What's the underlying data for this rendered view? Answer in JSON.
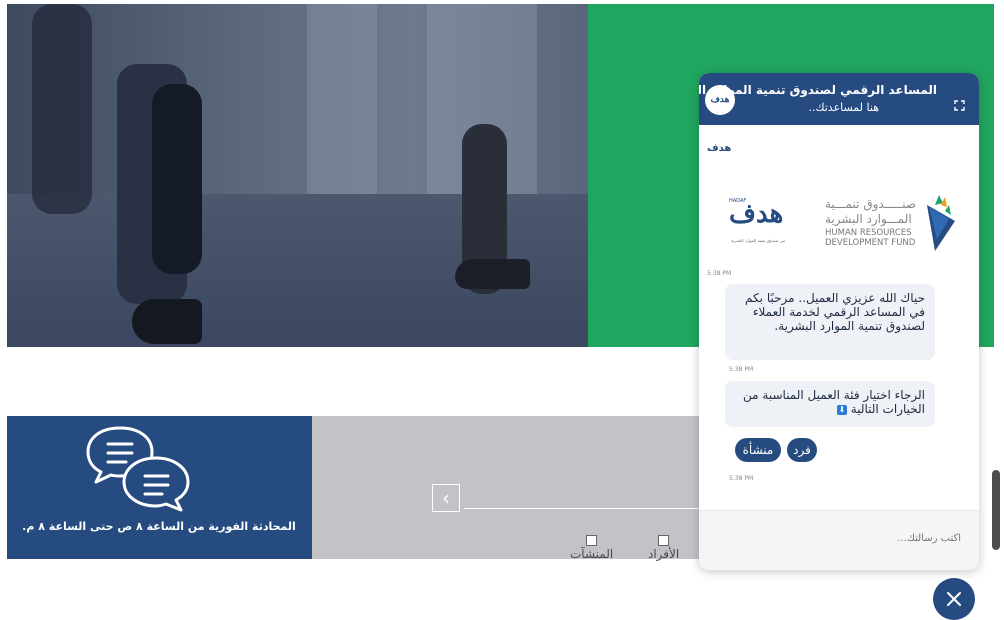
{
  "chat": {
    "title": "المساعد الرقمي لصندوق تنمية الموارد البشرية",
    "subtitle": "هنا لمساعدتك..",
    "logo_text": "هدف",
    "brand": {
      "ar_logo": "هدف",
      "tag": "HADAF",
      "small_sub": "من صندوق تنمية الموارد البشرية",
      "org_ar_line1": "صنـــــدوق تنمـــية",
      "org_ar_line2": "المـــوارد البشرية",
      "org_en_line1": "HUMAN RESOURCES",
      "org_en_line2": "DEVELOPMENT FUND"
    },
    "messages": [
      {
        "time": "5:38 PM"
      },
      {
        "time": "5:38 PM",
        "text": "حياك الله عزيزي العميل.. مرحبًا بكم في المساعد الرقمي لخدمة العملاء لصندوق تنمية الموارد البشرية."
      },
      {
        "time": "5:38 PM",
        "text": "الرجاء اختيار فئة العميل المناسبة من الخيارات التالية"
      },
      {
        "time": "5:38 PM"
      }
    ],
    "options": [
      "فرد",
      "منشأة"
    ],
    "input_placeholder": "اكتب رسالتك..."
  },
  "strip": {
    "support_text": "المحادثة الفورية من الساعة ٨ ص حتى الساعة ٨ م.",
    "prev_arrow": "‹",
    "checkboxes": [
      "الأفراد",
      "المنشآت"
    ]
  },
  "colors": {
    "primary": "#264b80",
    "green": "#20a65f",
    "gray_strip": "#c3c3c7"
  }
}
